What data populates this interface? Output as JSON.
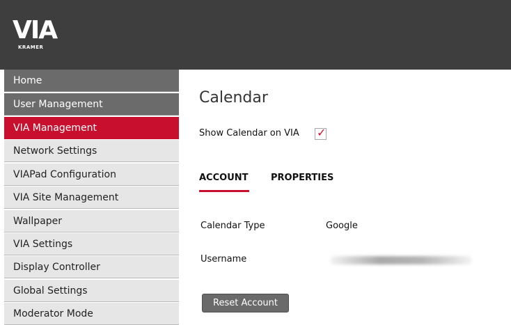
{
  "brand": {
    "logo_text": "VIA",
    "logo_subtext": "KRAMER"
  },
  "sidebar": {
    "items": [
      {
        "label": "Home",
        "state": "dark"
      },
      {
        "label": "User Management",
        "state": "dark"
      },
      {
        "label": "VIA Management",
        "state": "active"
      },
      {
        "label": "Network Settings",
        "state": "light"
      },
      {
        "label": "VIAPad Configuration",
        "state": "light"
      },
      {
        "label": "VIA Site Management",
        "state": "light"
      },
      {
        "label": "Wallpaper",
        "state": "light"
      },
      {
        "label": "VIA Settings",
        "state": "light"
      },
      {
        "label": "Display Controller",
        "state": "light"
      },
      {
        "label": "Global Settings",
        "state": "light"
      },
      {
        "label": "Moderator Mode",
        "state": "light"
      }
    ]
  },
  "main": {
    "title": "Calendar",
    "show_calendar": {
      "label": "Show Calendar on VIA",
      "checked": true
    },
    "tabs": [
      {
        "label": "ACCOUNT",
        "active": true
      },
      {
        "label": "PROPERTIES",
        "active": false
      }
    ],
    "fields": [
      {
        "label": "Calendar Type",
        "value": "Google"
      },
      {
        "label": "Username",
        "value": ""
      }
    ],
    "reset_button": "Reset Account"
  },
  "colors": {
    "topbar": "#3e3e3e",
    "accent_red": "#c8102e",
    "nav_dark": "#6b6b6b",
    "nav_light": "#e6e6e6",
    "button": "#6a6a6a"
  }
}
